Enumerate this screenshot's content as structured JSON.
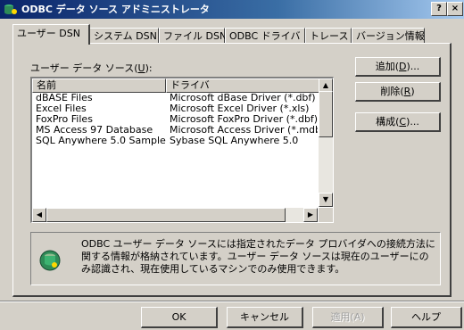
{
  "window": {
    "title": "ODBC データ ソース アドミニストレータ",
    "help_button": "?",
    "close_button": "×"
  },
  "tabs": [
    {
      "label": "ユーザー DSN",
      "active": true
    },
    {
      "label": "システム DSN",
      "active": false
    },
    {
      "label": "ファイル DSN",
      "active": false
    },
    {
      "label": "ODBC ドライバ",
      "active": false
    },
    {
      "label": "トレース",
      "active": false
    },
    {
      "label": "バージョン情報",
      "active": false
    }
  ],
  "user_dsn": {
    "list_label": "ユーザー データ ソース(",
    "list_label_key": "U",
    "list_label_end": "):",
    "columns": [
      "名前",
      "ドライバ"
    ],
    "rows": [
      {
        "name": "dBASE Files",
        "driver": "Microsoft dBase Driver (*.dbf)"
      },
      {
        "name": "Excel Files",
        "driver": "Microsoft Excel Driver (*.xls)"
      },
      {
        "name": "FoxPro Files",
        "driver": "Microsoft FoxPro Driver (*.dbf)"
      },
      {
        "name": "MS Access 97 Database",
        "driver": "Microsoft Access Driver (*.mdb)"
      },
      {
        "name": "SQL Anywhere 5.0 Sample",
        "driver": "Sybase SQL Anywhere 5.0"
      }
    ],
    "buttons": {
      "add": {
        "label": "追加(",
        "key": "D",
        "end": ")..."
      },
      "remove": {
        "label": "削除(",
        "key": "R",
        "end": ")"
      },
      "configure": {
        "label": "構成(",
        "key": "C",
        "end": ")..."
      }
    },
    "info_text": "ODBC ユーザー データ ソースには指定されたデータ プロバイダへの接続方法に関する情報が格納されています。ユーザー データ ソースは現在のユーザーにのみ認識され、現在使用しているマシンでのみ使用できます。"
  },
  "footer": {
    "ok": "OK",
    "cancel": "キャンセル",
    "apply": "適用(A)",
    "help": "ヘルプ"
  },
  "colors": {
    "title_start": "#0a246a",
    "title_end": "#a6caf0",
    "face": "#d4d0c8"
  }
}
